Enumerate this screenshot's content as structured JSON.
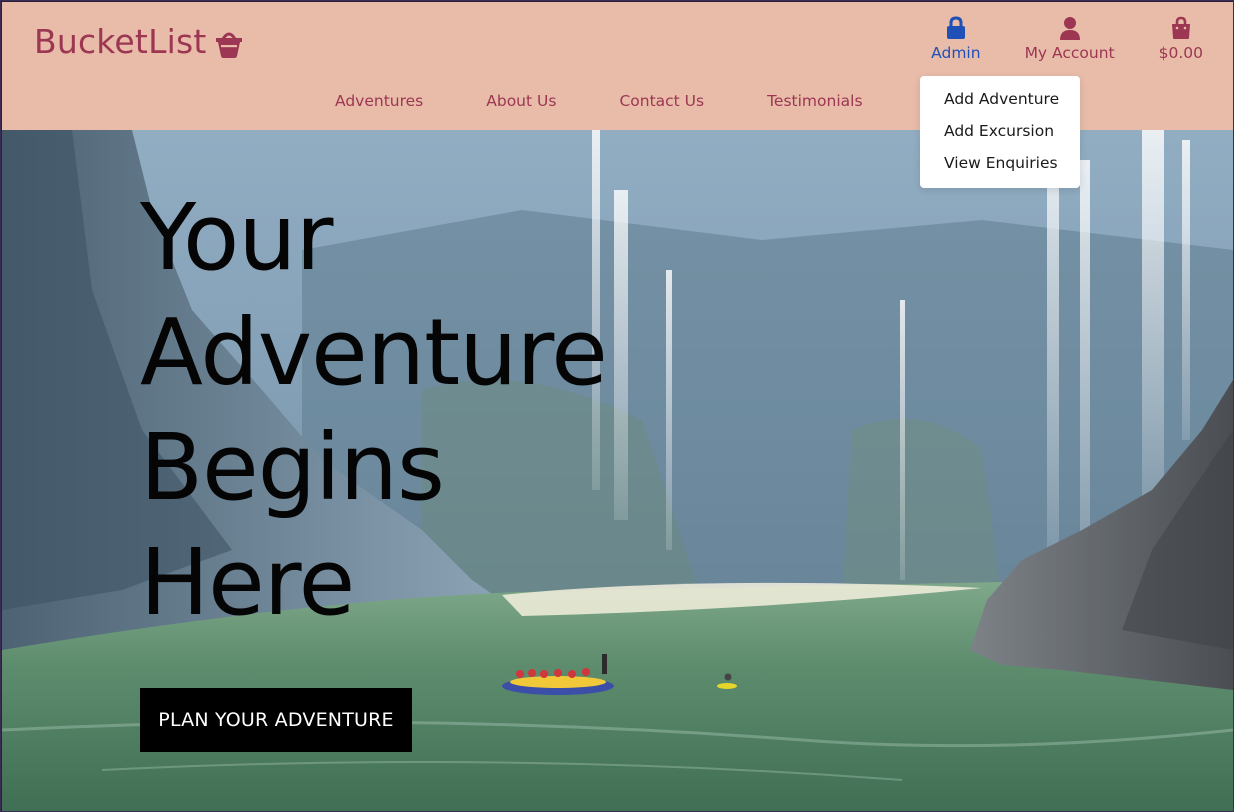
{
  "brand": {
    "name": "BucketList",
    "icon": "shopping-basket-icon"
  },
  "top_icons": [
    {
      "label": "Admin",
      "icon": "lock-icon",
      "color": "#1f50b8"
    },
    {
      "label": "My Account",
      "icon": "user-icon",
      "color": "#9c3652"
    },
    {
      "label": "$0.00",
      "icon": "shopping-bag-icon",
      "color": "#9c3652"
    }
  ],
  "nav": {
    "items": [
      "Adventures",
      "About Us",
      "Contact Us",
      "Testimonials"
    ]
  },
  "admin_dropdown": {
    "items": [
      "Add Adventure",
      "Add Excursion",
      "View Enquiries"
    ]
  },
  "hero": {
    "title_lines": [
      "Your",
      "Adventure",
      "Begins",
      "Here"
    ],
    "cta_label": "PLAN YOUR ADVENTURE"
  },
  "colors": {
    "header_bg": "#e8bca9",
    "brand": "#9c3652",
    "admin_accent": "#1f50b8",
    "cta_bg": "#000000"
  }
}
